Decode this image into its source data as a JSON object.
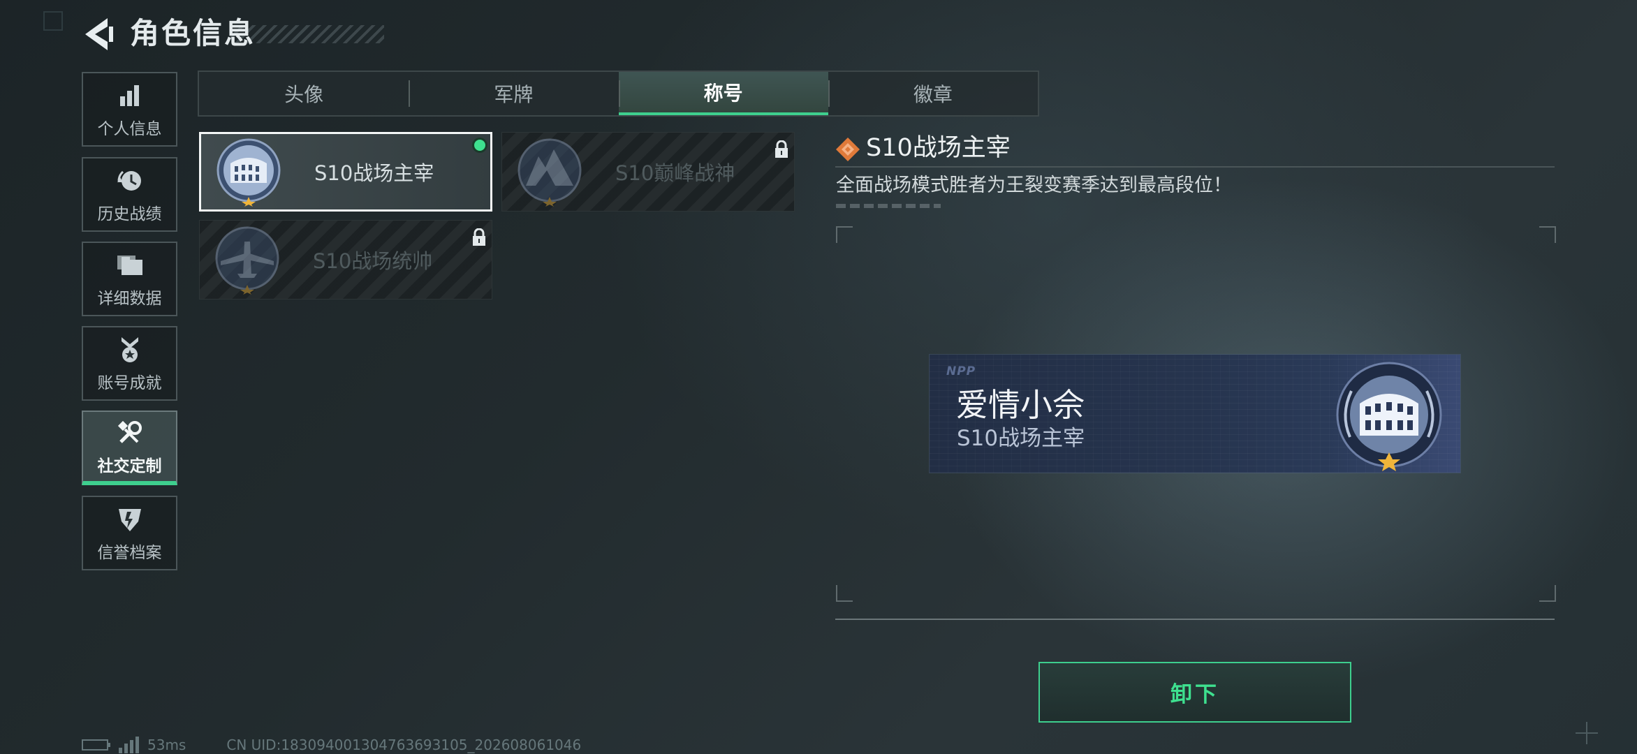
{
  "header": {
    "title": "角色信息",
    "back_icon": "chevron-left-icon"
  },
  "sidebar": {
    "items": [
      {
        "label": "个人信息",
        "icon": "bar-chart-icon",
        "active": false
      },
      {
        "label": "历史战绩",
        "icon": "history-clock-icon",
        "active": false
      },
      {
        "label": "详细数据",
        "icon": "folders-icon",
        "active": false
      },
      {
        "label": "账号成就",
        "icon": "medal-icon",
        "active": false
      },
      {
        "label": "社交定制",
        "icon": "tools-icon",
        "active": true
      },
      {
        "label": "信誉档案",
        "icon": "shield-badge-icon",
        "active": false
      }
    ]
  },
  "tabs": [
    {
      "label": "头像",
      "active": false
    },
    {
      "label": "军牌",
      "active": false
    },
    {
      "label": "称号",
      "active": true
    },
    {
      "label": "徽章",
      "active": false
    }
  ],
  "titles": [
    {
      "name": "S10战场主宰",
      "locked": false,
      "selected": true,
      "equipped": true,
      "medal": "colosseum-medal-icon"
    },
    {
      "name": "S10巅峰战神",
      "locked": true,
      "selected": false,
      "equipped": false,
      "medal": "mountain-medal-icon"
    },
    {
      "name": "S10战场统帅",
      "locked": true,
      "selected": false,
      "equipped": false,
      "medal": "aircraft-medal-icon"
    }
  ],
  "detail": {
    "title": "S10战场主宰",
    "description": "全面战场模式胜者为王裂变赛季达到最高段位！",
    "icon": "orange-diamond-icon"
  },
  "nameplate": {
    "logo": "NPP",
    "player_name": "爱情小佘",
    "title": "S10战场主宰"
  },
  "actions": {
    "unequip_label": "卸下"
  },
  "status": {
    "ping": "53ms",
    "uid": "CN UID:183094001304763693105_202608061046"
  },
  "colors": {
    "accent": "#3ecf8e",
    "detail_icon": "#e07a3a",
    "nameplate_bg": "#26344e"
  }
}
